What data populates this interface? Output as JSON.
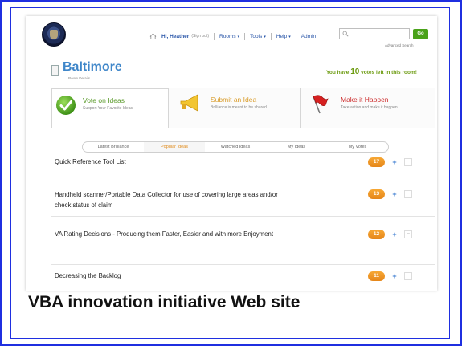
{
  "nav": {
    "greeting": "Hi, Heather",
    "signout": "(Sign out)",
    "rooms": "Rooms",
    "tools": "Tools",
    "help": "Help",
    "admin": "Admin",
    "caret": "▾",
    "search_placeholder": "",
    "go": "Go",
    "advanced_search": "Advanced Search"
  },
  "room": {
    "title": "Baltimore",
    "details": "Room Details",
    "votes_prefix": "You have ",
    "votes_count": "10",
    "votes_suffix": " votes left in this room!"
  },
  "actions": [
    {
      "title": "Vote on Ideas",
      "subtitle": "Support Your Favorite Ideas",
      "icon": "check-icon"
    },
    {
      "title": "Submit an Idea",
      "subtitle": "Brilliance is meant to be shared",
      "icon": "megaphone-icon"
    },
    {
      "title": "Make it Happen",
      "subtitle": "Take action and make it happen",
      "icon": "flag-icon"
    }
  ],
  "subtabs": [
    "Latest Brilliance",
    "Popular Ideas",
    "Watched Ideas",
    "My Ideas",
    "My Votes"
  ],
  "active_subtab": "Popular Ideas",
  "ideas": [
    {
      "title": "Quick Reference Tool List",
      "votes": "17"
    },
    {
      "title": "Handheld scanner/Portable Data Collector for use of covering large areas and/or check status of claim",
      "votes": "13"
    },
    {
      "title": "VA Rating Decisions - Producing them Faster, Easier and with more Enjoyment",
      "votes": "12"
    },
    {
      "title": "Decreasing the Backlog",
      "votes": "11"
    }
  ],
  "vote_plus": "+",
  "vote_minus": "−",
  "caption": "VBA innovation initiative Web site",
  "colors": {
    "frame": "#1f2fe0",
    "accent_blue": "#3f86c9",
    "badge_orange": "#f19a2a",
    "go_green": "#4aa21a"
  }
}
